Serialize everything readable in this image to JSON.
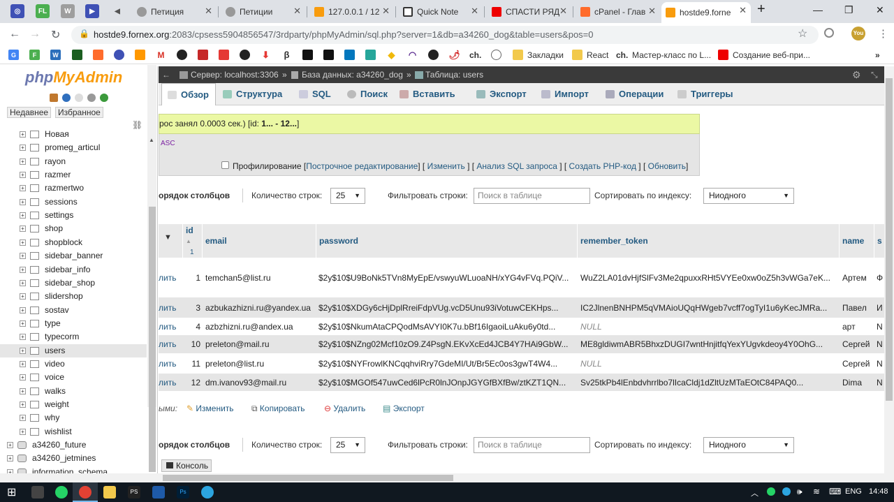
{
  "browser": {
    "tabs": [
      {
        "title": "Петиция",
        "active": false
      },
      {
        "title": "Петиции",
        "active": false
      },
      {
        "title": "127.0.0.1 / 12",
        "active": false
      },
      {
        "title": "Quick Note",
        "active": false
      },
      {
        "title": "СПАСТИ РЯД",
        "active": false
      },
      {
        "title": "cPanel - Глав",
        "active": false
      },
      {
        "title": "hostde9.forne",
        "active": true
      }
    ],
    "pinned": [
      "FL",
      "W"
    ],
    "url_host": "hostde9.fornex.org",
    "url_path": ":2083/cpsess5904856547/3rdparty/phpMyAdmin/sql.php?server=1&db=a34260_dog&table=users&pos=0",
    "profile_label": "You",
    "bookmarks": [
      "Закладки",
      "React",
      "ch.",
      "Мастер-класс по L...",
      "Создание веб-при..."
    ]
  },
  "sidebar": {
    "logo_a": "php",
    "logo_b": "MyAdmin",
    "recent": "Недавнее",
    "favorites": "Избранное",
    "items": [
      {
        "label": "Новая",
        "level": 2
      },
      {
        "label": "promeg_articul",
        "level": 2
      },
      {
        "label": "rayon",
        "level": 2
      },
      {
        "label": "razmer",
        "level": 2
      },
      {
        "label": "razmertwo",
        "level": 2
      },
      {
        "label": "sessions",
        "level": 2
      },
      {
        "label": "settings",
        "level": 2
      },
      {
        "label": "shop",
        "level": 2
      },
      {
        "label": "shopblock",
        "level": 2
      },
      {
        "label": "sidebar_banner",
        "level": 2
      },
      {
        "label": "sidebar_info",
        "level": 2
      },
      {
        "label": "sidebar_shop",
        "level": 2
      },
      {
        "label": "slidershop",
        "level": 2
      },
      {
        "label": "sostav",
        "level": 2
      },
      {
        "label": "type",
        "level": 2
      },
      {
        "label": "typecorm",
        "level": 2
      },
      {
        "label": "users",
        "level": 2,
        "selected": true
      },
      {
        "label": "video",
        "level": 2
      },
      {
        "label": "voice",
        "level": 2
      },
      {
        "label": "walks",
        "level": 2
      },
      {
        "label": "weight",
        "level": 2
      },
      {
        "label": "why",
        "level": 2
      },
      {
        "label": "wishlist",
        "level": 2
      },
      {
        "label": "a34260_future",
        "level": 1
      },
      {
        "label": "a34260_jetmines",
        "level": 1
      },
      {
        "label": "information_schema",
        "level": 1
      }
    ]
  },
  "breadcrumb": {
    "server": "Сервер: localhost:3306",
    "db": "База данных: a34260_dog",
    "table": "Таблица: users"
  },
  "menu": [
    {
      "label": "Обзор",
      "active": true
    },
    {
      "label": "Структура"
    },
    {
      "label": "SQL"
    },
    {
      "label": "Поиск"
    },
    {
      "label": "Вставить"
    },
    {
      "label": "Экспорт"
    },
    {
      "label": "Импорт"
    },
    {
      "label": "Операции"
    },
    {
      "label": "Триггеры"
    }
  ],
  "notice": {
    "prefix": "рос занял 0.0003 сек.) [id: ",
    "range": "1... - 12...",
    "suffix": "]"
  },
  "sql": {
    "text": "ASC",
    "profiling": "Профилирование",
    "links": [
      "Построчное редактирование",
      "Изменить",
      "Анализ SQL запроса",
      "Создать PHP-код",
      "Обновить"
    ]
  },
  "controls": {
    "column_order": "орядок столбцов",
    "rows_label": "Количество строк:",
    "rows_value": "25",
    "filter_label": "Фильтровать строки:",
    "filter_placeholder": "Поиск в таблице",
    "sort_label": "Сортировать по индексу:",
    "sort_value": "Ниодного"
  },
  "table": {
    "headers": [
      "id",
      "email",
      "password",
      "remember_token",
      "name",
      "s"
    ],
    "sort_indicator": "1",
    "delete_label": "лить",
    "rows": [
      {
        "id": "1",
        "email": "temchan5@list.ru",
        "password": "$2y$10$U9BoNk5TVn8MyEpE/vswyuWLuoaNH/xYG4vFVq.PQiV...",
        "token": "WuZ2LA01dvHjfSlFv3Me2qpuxxRHt5VYEe0xw0oZ5h3vWGa7eK...",
        "name": "Артем",
        "s": "Ф"
      },
      {
        "id": "3",
        "email": "azbukazhizni.ru@yandex.ua",
        "password": "$2y$10$XDGy6cHjDplRreiFdpVUg.vcD5Unu93iVotuwCEKHps...",
        "token": "IC2JlnenBNHPM5qVMAioUQqHWgeb7vcff7ogTyI1u6yKecJMRa...",
        "name": "Павел",
        "s": "И"
      },
      {
        "id": "4",
        "email": "azbzhizni.ru@andex.ua",
        "password": "$2y$10$NkumAtaCPQodMsAVYI0K7u.bBf16IgaoiLuAku6y0td...",
        "token": "NULL",
        "name": "арт",
        "s": "N"
      },
      {
        "id": "10",
        "email": "preleton@mail.ru",
        "password": "$2y$10$NZng02Mcf10zO9.Z4PsgN.EKvXcEd4JCB4Y7HAi9GbW...",
        "token": "ME8gldiwmABR5BhxzDUGI7wntHnjitfqYexYUgvkdeoy4Y0OhG...",
        "name": "Сергей",
        "s": "N"
      },
      {
        "id": "11",
        "email": "preleton@list.ru",
        "password": "$2y$10$NYFrowlKNCqqhviRry7GdeMI/Ut/Br5Ec0os3gwT4W4...",
        "token": "NULL",
        "name": "Сергей",
        "s": "N"
      },
      {
        "id": "12",
        "email": "dm.ivanov93@mail.ru",
        "password": "$2y$10$MGOf547uwCed6lPcR0lnJOnpJGYGfBXfBw/ztKZT1QN...",
        "token": "Sv25tkPb4lEnbdvhrrlbo7lIcaCldj1dZltUzMTaEOtC84PAQ0...",
        "name": "Dima",
        "s": "N"
      }
    ]
  },
  "with_selected": {
    "label": "ыми:",
    "edit": "Изменить",
    "copy": "Копировать",
    "delete": "Удалить",
    "export": "Экспорт"
  },
  "console": "Консоль",
  "taskbar": {
    "lang": "ENG",
    "time": "14:48"
  }
}
